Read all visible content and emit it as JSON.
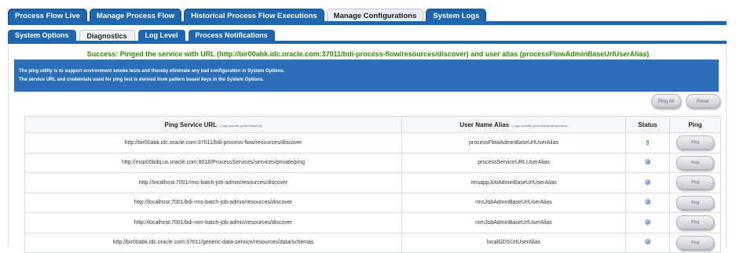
{
  "top_tabs": [
    {
      "label": "Process Flow Live",
      "active": false
    },
    {
      "label": "Manage Process Flow",
      "active": false
    },
    {
      "label": "Historical Process Flow Executions",
      "active": false
    },
    {
      "label": "Manage Configurations",
      "active": true
    },
    {
      "label": "System Logs",
      "active": false
    }
  ],
  "sub_tabs": [
    {
      "label": "System Options",
      "active": false
    },
    {
      "label": "Diagnostics",
      "active": true
    },
    {
      "label": "Log Level",
      "active": false
    },
    {
      "label": "Process Notifications",
      "active": false
    }
  ],
  "success_message": "Success: Pinged the service with URL (http://bir00abk.idc.oracle.com:37011/bdi-process-flow/resources/discover) and user alias (processFlowAdminBaseUrlUserAlias)",
  "info": {
    "line1": "The ping utility is to support environment smoke tests and thereby eliminate any bad configuration in System Options.",
    "line2": "The service URL and credentials used for ping test is derived from pattern based keys in the System Options."
  },
  "buttons": {
    "ping_all": "Ping All",
    "reset": "Reset"
  },
  "table": {
    "headers": {
      "url": "Ping Service URL",
      "url_hint": "(<app specific prefix>BaseUrl)",
      "alias": "User Name Alias",
      "alias_hint": "(<app specific prefix>BaseUrlUserAlias)",
      "status": "Status",
      "ping": "Ping"
    },
    "ping_label": "Ping",
    "rows": [
      {
        "url": "http://bir00abk.idc.oracle.com:37011/bdi-process-flow/resources/discover",
        "alias": "processFlowAdminBaseUrlUserAlias",
        "status": "success"
      },
      {
        "url": "http://msp00bdq.us.oracle.com:8018/ProcessServices/services/private/ping",
        "alias": "processServiceURLUserAlias",
        "status": "unknown"
      },
      {
        "url": "http://localhost:7001/rms-batch-job-admin/resources/discover",
        "alias": "rmsappJobAdminBaseUrlUserAlias",
        "status": "unknown"
      },
      {
        "url": "http://localhost:7001/bdi-rms-batch-job-admin/resources/discover",
        "alias": "rmsJobAdminBaseUrlUserAlias",
        "status": "unknown"
      },
      {
        "url": "http://localhost:7001/bdi-rxm-batch-job-admin/resources/discover",
        "alias": "rxmJobAdminBaseUrlUserAlias",
        "status": "unknown"
      },
      {
        "url": "http://bir00abk.idc.oracle.com:37011/generic-data-service/resources/data/schemas",
        "alias": "localGDSUrlUserAlias",
        "status": "unknown"
      }
    ]
  }
}
